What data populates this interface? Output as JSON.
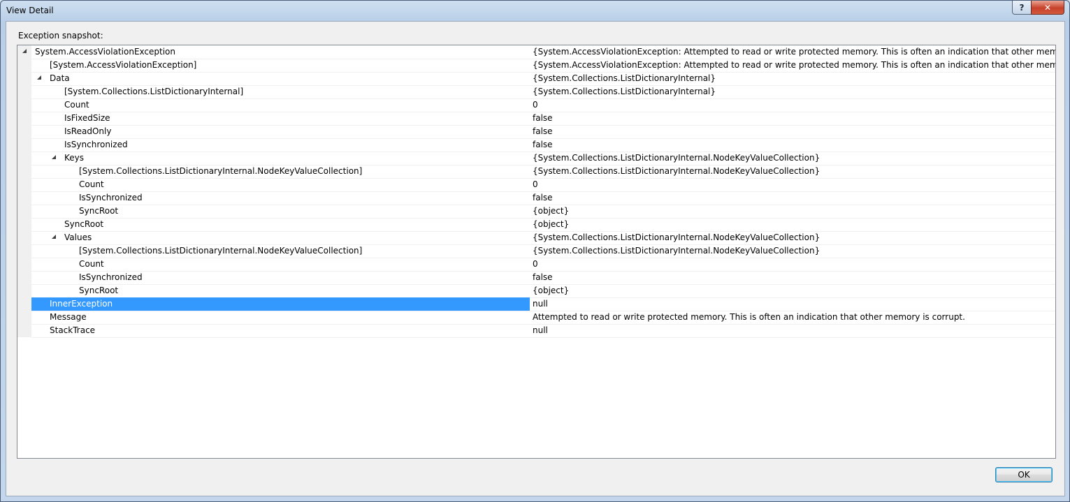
{
  "window": {
    "title": "View Detail",
    "help_label": "?",
    "close_label": "✕"
  },
  "snapshot_label": "Exception snapshot:",
  "rows": [
    {
      "level": 0,
      "expander": true,
      "name": "System.AccessViolationException",
      "value": "{System.AccessViolationException: Attempted to read or write protected memory. This is often an indication that other memory is corrupt.}"
    },
    {
      "level": 1,
      "expander": false,
      "name": "[System.AccessViolationException]",
      "value": "{System.AccessViolationException: Attempted to read or write protected memory. This is often an indication that other memory is corrupt.}"
    },
    {
      "level": 1,
      "expander": true,
      "name": "Data",
      "value": "{System.Collections.ListDictionaryInternal}"
    },
    {
      "level": 2,
      "expander": false,
      "name": "[System.Collections.ListDictionaryInternal]",
      "value": "{System.Collections.ListDictionaryInternal}"
    },
    {
      "level": 2,
      "expander": false,
      "name": "Count",
      "value": "0"
    },
    {
      "level": 2,
      "expander": false,
      "name": "IsFixedSize",
      "value": "false"
    },
    {
      "level": 2,
      "expander": false,
      "name": "IsReadOnly",
      "value": "false"
    },
    {
      "level": 2,
      "expander": false,
      "name": "IsSynchronized",
      "value": "false"
    },
    {
      "level": 2,
      "expander": true,
      "name": "Keys",
      "value": "{System.Collections.ListDictionaryInternal.NodeKeyValueCollection}"
    },
    {
      "level": 3,
      "expander": false,
      "name": "[System.Collections.ListDictionaryInternal.NodeKeyValueCollection]",
      "value": "{System.Collections.ListDictionaryInternal.NodeKeyValueCollection}"
    },
    {
      "level": 3,
      "expander": false,
      "name": "Count",
      "value": "0"
    },
    {
      "level": 3,
      "expander": false,
      "name": "IsSynchronized",
      "value": "false"
    },
    {
      "level": 3,
      "expander": false,
      "name": "SyncRoot",
      "value": "{object}"
    },
    {
      "level": 2,
      "expander": false,
      "name": "SyncRoot",
      "value": "{object}"
    },
    {
      "level": 2,
      "expander": true,
      "name": "Values",
      "value": "{System.Collections.ListDictionaryInternal.NodeKeyValueCollection}"
    },
    {
      "level": 3,
      "expander": false,
      "name": "[System.Collections.ListDictionaryInternal.NodeKeyValueCollection]",
      "value": "{System.Collections.ListDictionaryInternal.NodeKeyValueCollection}"
    },
    {
      "level": 3,
      "expander": false,
      "name": "Count",
      "value": "0"
    },
    {
      "level": 3,
      "expander": false,
      "name": "IsSynchronized",
      "value": "false"
    },
    {
      "level": 3,
      "expander": false,
      "name": "SyncRoot",
      "value": "{object}"
    },
    {
      "level": 1,
      "expander": false,
      "name": "InnerException",
      "value": "null",
      "selected": true
    },
    {
      "level": 1,
      "expander": false,
      "name": "Message",
      "value": "Attempted to read or write protected memory. This is often an indication that other memory is corrupt."
    },
    {
      "level": 1,
      "expander": false,
      "name": "StackTrace",
      "value": "null"
    }
  ],
  "ok_label": "OK",
  "colors": {
    "selection": "#3399ff",
    "close_button": "#c8412b",
    "ok_border": "#3c7fb1"
  }
}
